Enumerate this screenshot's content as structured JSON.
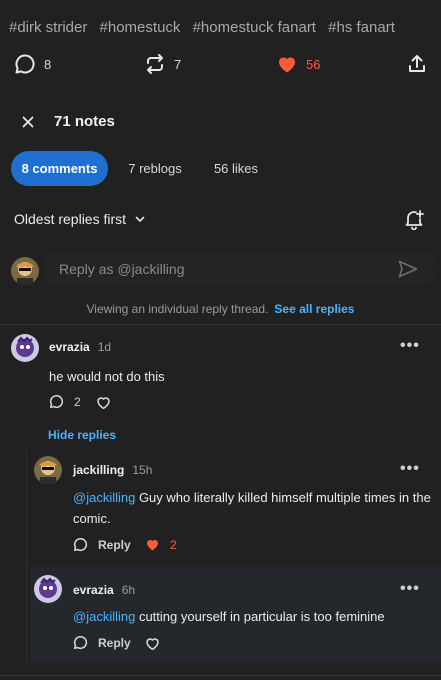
{
  "tags": [
    "#dirk strider",
    "#homestuck",
    "#homestuck fanart",
    "#hs fanart"
  ],
  "post_actions": {
    "comments_count": "8",
    "reblogs_count": "7",
    "likes_count": "56",
    "like_color": "#ff5a3c"
  },
  "notes": {
    "title": "71 notes",
    "tabs": [
      {
        "label": "8 comments",
        "active": true
      },
      {
        "label": "7 reblogs",
        "active": false
      },
      {
        "label": "56 likes",
        "active": false
      }
    ],
    "sort_label": "Oldest replies first"
  },
  "reply_input": {
    "placeholder": "Reply as @jackilling"
  },
  "thread_notice": {
    "text": "Viewing an individual reply thread.",
    "link": "See all replies"
  },
  "comments": [
    {
      "username": "evrazia",
      "ago": "1d",
      "text": "he would not do this",
      "reply_count": "2"
    }
  ],
  "hide_replies_label": "Hide replies",
  "replies": [
    {
      "username": "jackilling",
      "ago": "15h",
      "mention": "@jackilling",
      "text": " Guy who literally killed himself multiple times in the comic.",
      "reply_label": "Reply",
      "likes": "2"
    },
    {
      "username": "evrazia",
      "ago": "6h",
      "mention": "@jackilling",
      "text": " cutting yourself in particular is too feminine",
      "reply_label": "Reply"
    }
  ],
  "colors": {
    "accent_blue": "#1f6fd1",
    "link_blue": "#4ab3ff",
    "background": "#212121"
  }
}
